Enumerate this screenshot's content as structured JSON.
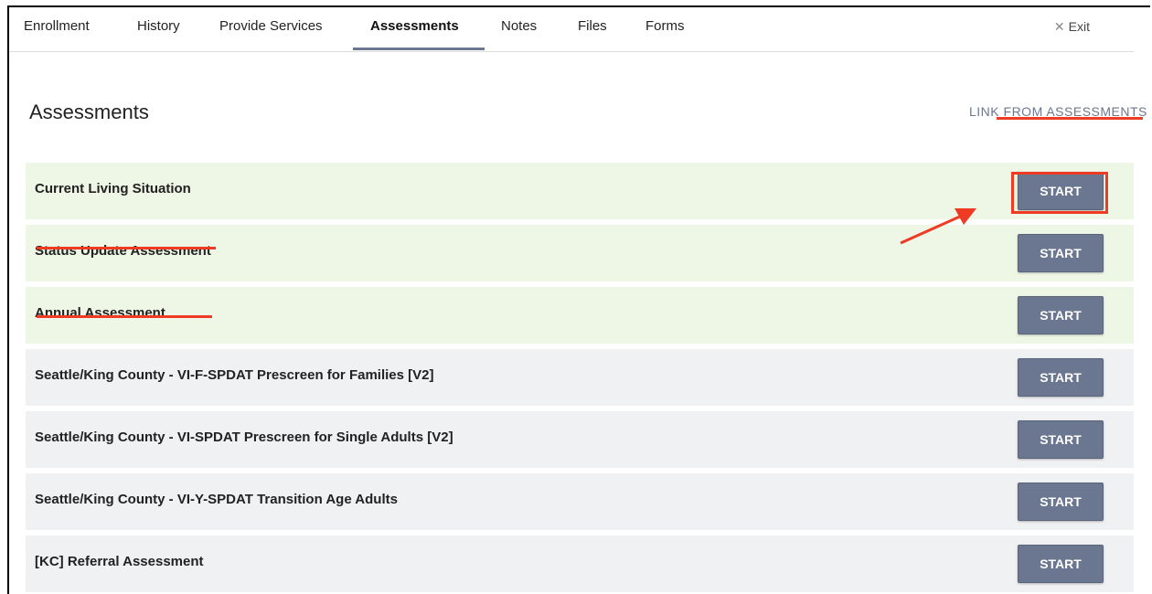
{
  "tabs": [
    {
      "label": "Enrollment",
      "active": false
    },
    {
      "label": "History",
      "active": false
    },
    {
      "label": "Provide Services",
      "active": false
    },
    {
      "label": "Assessments",
      "active": true
    },
    {
      "label": "Notes",
      "active": false
    },
    {
      "label": "Files",
      "active": false
    },
    {
      "label": "Forms",
      "active": false
    }
  ],
  "exit": {
    "icon": "close-icon",
    "glyph": "✕",
    "label": "Exit"
  },
  "page": {
    "title": "Assessments",
    "link_label": "LINK FROM ASSESSMENTS"
  },
  "assessments": [
    {
      "name": "Current Living Situation",
      "button": "START",
      "row_style": "green"
    },
    {
      "name": "Status Update Assessment",
      "button": "START",
      "row_style": "green"
    },
    {
      "name": "Annual Assessment",
      "button": "START",
      "row_style": "green"
    },
    {
      "name": "Seattle/King County - VI-F-SPDAT Prescreen for Families [V2]",
      "button": "START",
      "row_style": "gray"
    },
    {
      "name": "Seattle/King County - VI-SPDAT Prescreen for Single Adults [V2]",
      "button": "START",
      "row_style": "gray"
    },
    {
      "name": "Seattle/King County - VI-Y-SPDAT Transition Age Adults",
      "button": "START",
      "row_style": "gray"
    },
    {
      "name": "[KC] Referral Assessment",
      "button": "START",
      "row_style": "gray"
    }
  ],
  "colors": {
    "accent": "#6b7790",
    "annotation_red": "#ef3b24",
    "row_green": "#eef6e6",
    "row_gray": "#f0f1f3"
  }
}
